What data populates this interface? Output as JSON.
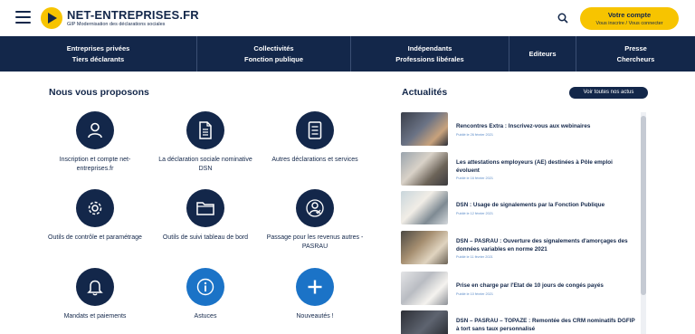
{
  "header": {
    "logo_name": "NET-ENTREPRISES.FR",
    "logo_sub": "GIP Modernisation des déclarations sociales",
    "account_title": "Votre compte",
    "account_sub": "Vous inscrire / Vous connecter"
  },
  "nav": {
    "items": [
      {
        "line1": "Entreprises privées",
        "line2": "Tiers déclarants"
      },
      {
        "line1": "Collectivités",
        "line2": "Fonction publique"
      },
      {
        "line1": "Indépendants",
        "line2": "Professions libérales"
      },
      {
        "line1": "Editeurs",
        "line2": ""
      },
      {
        "line1": "Presse",
        "line2": "Chercheurs"
      }
    ]
  },
  "services": {
    "title": "Nous vous proposons",
    "items": [
      {
        "label": "Inscription et compte net-entreprises.fr",
        "icon": "user-icon"
      },
      {
        "label": "La déclaration sociale nominative DSN",
        "icon": "document-icon"
      },
      {
        "label": "Autres déclarations et services",
        "icon": "document-list-icon"
      },
      {
        "label": "Outils de contrôle et paramétrage",
        "icon": "gear-icon"
      },
      {
        "label": "Outils de suivi tableau de bord",
        "icon": "folder-icon"
      },
      {
        "label": "Passage pour les revenus autres - PASRAU",
        "icon": "user-check-icon"
      },
      {
        "label": "Mandats et paiements",
        "icon": "bell-icon"
      },
      {
        "label": "Astuces",
        "icon": "info-icon"
      },
      {
        "label": "Nouveautés !",
        "icon": "plus-icon"
      }
    ]
  },
  "news": {
    "title": "Actualités",
    "all_button": "Voir toutes nos actus",
    "items": [
      {
        "title": "Rencontres Extra : Inscrivez-vous aux webinaires",
        "date": "Publié le 26 février 2021"
      },
      {
        "title": "Les attestations employeurs (AE) destinées à Pôle emploi évoluent",
        "date": "Publié le 16 février 2021"
      },
      {
        "title": "DSN : Usage de signalements par la Fonction Publique",
        "date": "Publié le 12 février 2021"
      },
      {
        "title": "DSN – PASRAU : Ouverture des signalements d'amorçages des données variables en norme 2021",
        "date": "Publié le 11 février 2021"
      },
      {
        "title": "Prise en charge par l'Etat de 10 jours de congés payés",
        "date": "Publié le 10 février 2021"
      },
      {
        "title": "DSN – PASRAU – TOPAZE : Remontée des CRM nominatifs DGFIP à tort sans taux personnalisé",
        "date": ""
      }
    ]
  },
  "colors": {
    "navy": "#13274a",
    "yellow": "#f7c400",
    "blue": "#1b73c7"
  }
}
